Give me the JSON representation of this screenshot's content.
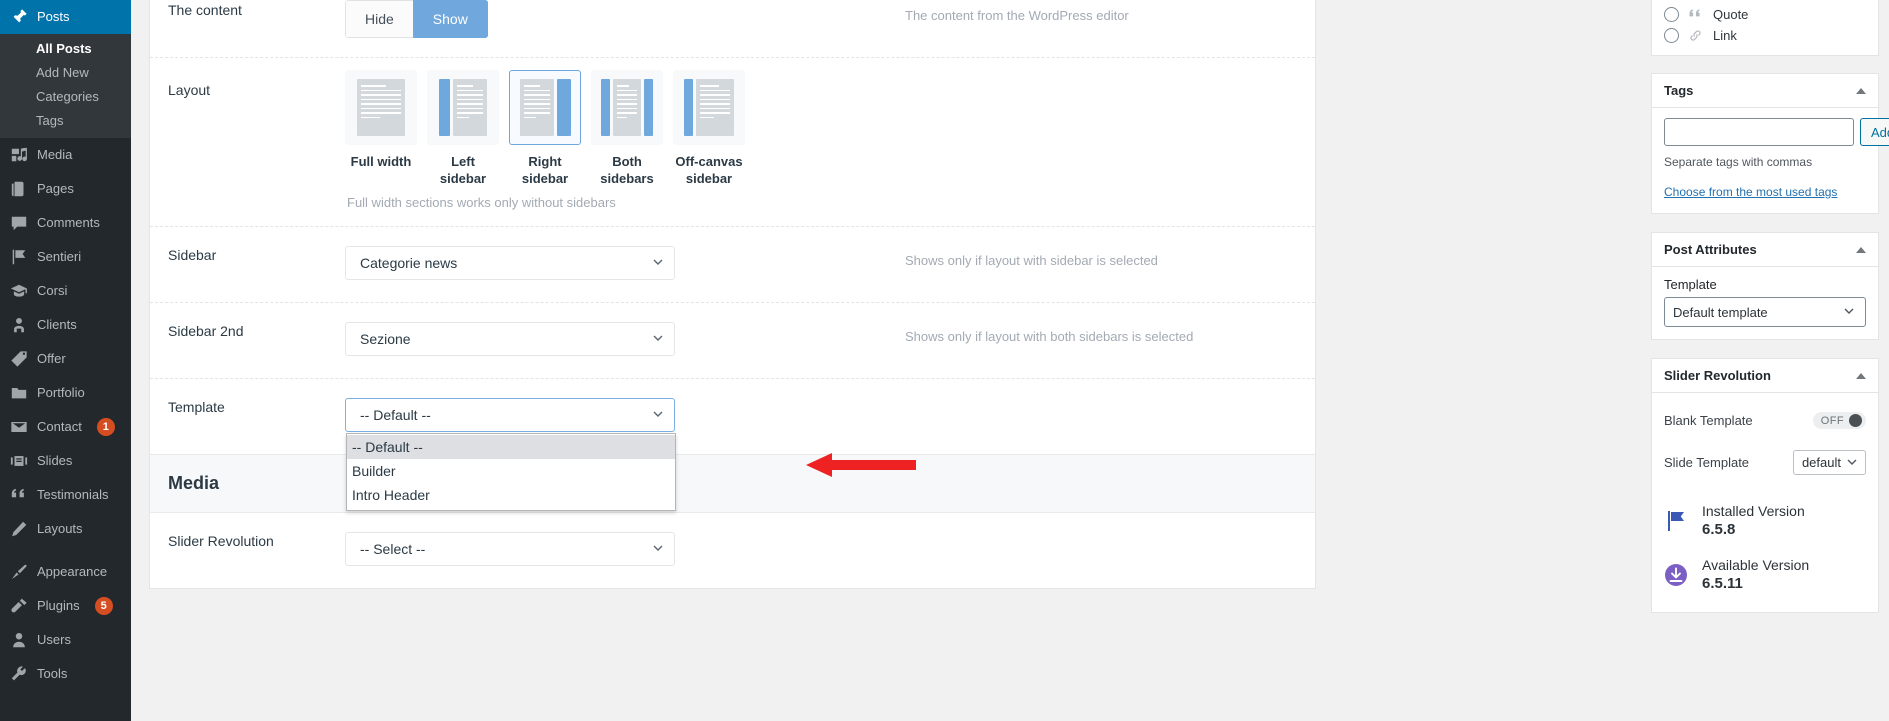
{
  "sidebar": {
    "current": {
      "label": "Posts",
      "icon": "pin-icon",
      "submenu": [
        {
          "label": "All Posts",
          "current": true
        },
        {
          "label": "Add New",
          "current": false
        },
        {
          "label": "Categories",
          "current": false
        },
        {
          "label": "Tags",
          "current": false
        }
      ]
    },
    "items": [
      {
        "label": "Media",
        "icon": "media-icon",
        "badge": ""
      },
      {
        "label": "Pages",
        "icon": "pages-icon",
        "badge": ""
      },
      {
        "label": "Comments",
        "icon": "comments-icon",
        "badge": ""
      },
      {
        "label": "Sentieri",
        "icon": "flag-icon",
        "badge": ""
      },
      {
        "label": "Corsi",
        "icon": "graduation-cap-icon",
        "badge": ""
      },
      {
        "label": "Clients",
        "icon": "user-badge-icon",
        "badge": ""
      },
      {
        "label": "Offer",
        "icon": "tag-stack-icon",
        "badge": ""
      },
      {
        "label": "Portfolio",
        "icon": "portfolio-icon",
        "badge": ""
      },
      {
        "label": "Contact",
        "icon": "envelope-icon",
        "badge": "1"
      },
      {
        "label": "Slides",
        "icon": "slides-icon",
        "badge": ""
      },
      {
        "label": "Testimonials",
        "icon": "quote-icon",
        "badge": ""
      },
      {
        "label": "Layouts",
        "icon": "pencil-icon",
        "badge": ""
      }
    ],
    "items2": [
      {
        "label": "Appearance",
        "icon": "brush-icon",
        "badge": ""
      },
      {
        "label": "Plugins",
        "icon": "plug-icon",
        "badge": "5"
      },
      {
        "label": "Users",
        "icon": "user-icon",
        "badge": ""
      },
      {
        "label": "Tools",
        "icon": "wrench-icon",
        "badge": ""
      }
    ]
  },
  "main": {
    "content_row": {
      "label": "The content",
      "buttons": [
        "Hide",
        "Show"
      ],
      "active_button": "Show",
      "description": "The content from the WordPress editor"
    },
    "layout_row": {
      "label": "Layout",
      "options": [
        {
          "caption": "Full width",
          "selected": false
        },
        {
          "caption": "Left sidebar",
          "selected": false
        },
        {
          "caption": "Right sidebar",
          "selected": true
        },
        {
          "caption": "Both sidebars",
          "selected": false
        },
        {
          "caption": "Off-canvas sidebar",
          "selected": false
        }
      ],
      "hint": "Full width sections works only without sidebars"
    },
    "sidebar_row": {
      "label": "Sidebar",
      "value": "Categorie news",
      "description": "Shows only if layout with sidebar is selected"
    },
    "sidebar2_row": {
      "label": "Sidebar 2nd",
      "value": "Sezione",
      "description": "Shows only if layout with both sidebars is selected"
    },
    "template_row": {
      "label": "Template",
      "value": "-- Default --",
      "open": true,
      "options": [
        {
          "label": "-- Default --",
          "highlighted": true
        },
        {
          "label": "Builder",
          "highlighted": false
        },
        {
          "label": "Intro Header",
          "highlighted": false
        }
      ]
    },
    "media_section": {
      "title": "Media",
      "slider_row": {
        "label": "Slider Revolution",
        "value": "-- Select --"
      }
    }
  },
  "right": {
    "formats": [
      {
        "label": "Quote",
        "icon": "quote-icon",
        "selected": false
      },
      {
        "label": "Link",
        "icon": "link-icon",
        "selected": false
      }
    ],
    "tags_box": {
      "title": "Tags",
      "input_value": "",
      "input_placeholder": "",
      "add_label": "Add",
      "note": "Separate tags with commas",
      "link": "Choose from the most used tags"
    },
    "post_attributes_box": {
      "title": "Post Attributes",
      "template_label": "Template",
      "template_value": "Default template"
    },
    "slider_revolution_box": {
      "title": "Slider Revolution",
      "blank_template_label": "Blank Template",
      "blank_template_state": "OFF",
      "slide_template_label": "Slide Template",
      "slide_template_value": "default",
      "installed_label": "Installed Version",
      "installed_value": "6.5.8",
      "available_label": "Available Version",
      "available_value": "6.5.11"
    }
  },
  "colors": {
    "accent": "#0073aa",
    "sidebar_bg": "#23282d",
    "submenu_bg": "#32373c",
    "blue_thumb": "#6fa8dc",
    "badge_red": "#d54e21",
    "arrow_red": "#ee2222",
    "link_blue": "#2271b1"
  }
}
